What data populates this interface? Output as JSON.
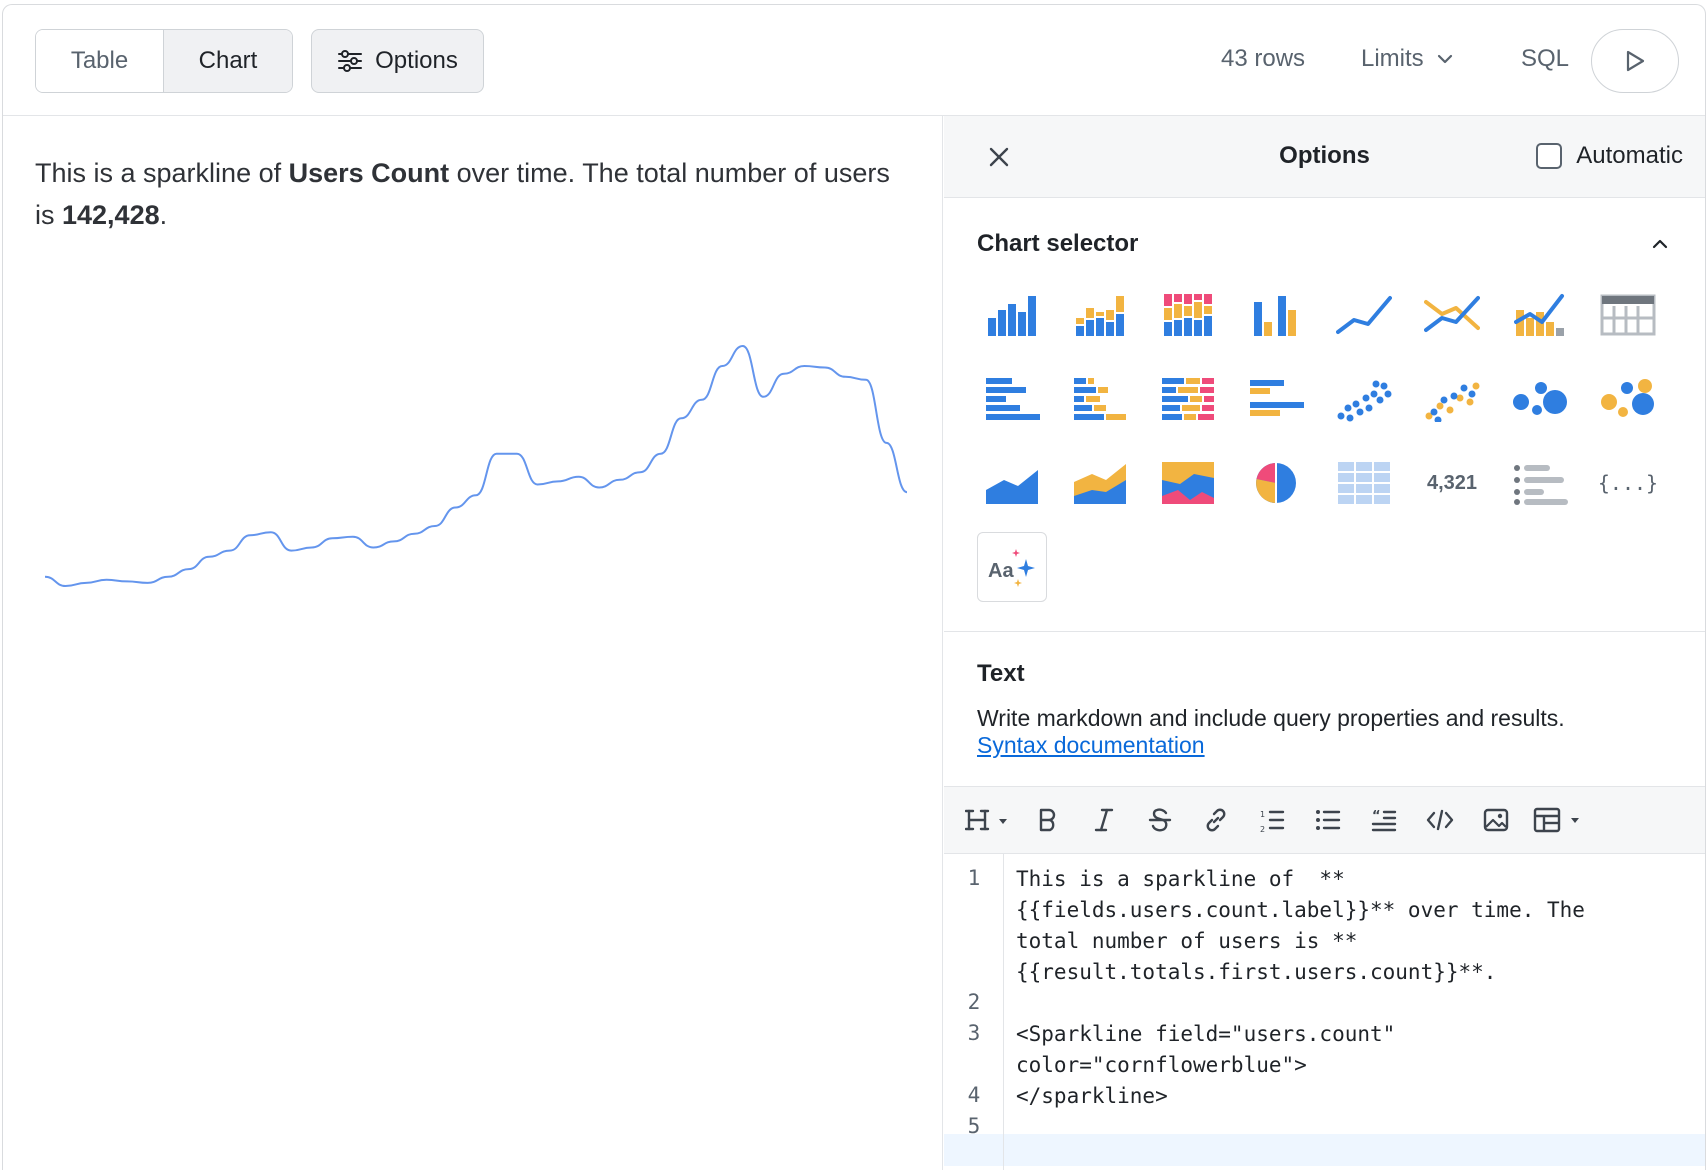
{
  "toolbar": {
    "tab_table": "Table",
    "tab_chart": "Chart",
    "options_label": "Options",
    "rows_label": "43 rows",
    "limits_label": "Limits",
    "sql_label": "SQL"
  },
  "left": {
    "text_pre": "This is a sparkline of ",
    "text_bold1": "Users Count",
    "text_mid": " over time. The total number of users is ",
    "text_bold2": "142,428",
    "text_post": ".",
    "sparkline_color": "#6495ed"
  },
  "chart_data": {
    "type": "line",
    "title": "",
    "xlabel": "",
    "ylabel": "",
    "grid": false,
    "series": [
      {
        "values": [
          95,
          89,
          91,
          93,
          92,
          91,
          95,
          100,
          108,
          112,
          122,
          124,
          112,
          114,
          120,
          121,
          114,
          118,
          123,
          128,
          140,
          148,
          175,
          175,
          155,
          157,
          160,
          153,
          158,
          163,
          175,
          198,
          210,
          232,
          245,
          212,
          227,
          232,
          231,
          225,
          223,
          182,
          150
        ]
      }
    ]
  },
  "panel": {
    "title": "Options",
    "automatic_label": "Automatic",
    "chart_selector_title": "Chart selector",
    "kpi_sample": "4,321",
    "json_sample": "{...}",
    "text_icon_label": "Aa",
    "text_section_title": "Text",
    "text_description": "Write markdown and include query properties and results.",
    "syntax_link": "Syntax documentation"
  },
  "colors": {
    "blue": "#2f7ee0",
    "yellow": "#f2b441",
    "pink": "#ef4b7a",
    "light_blue": "#bcd4f3",
    "grey": "#9aa1a9"
  },
  "editor": {
    "line_numbers": [
      "1",
      "2",
      "3",
      "4",
      "5"
    ],
    "code_lines": [
      "This is a sparkline of  **",
      "{{fields.users.count.label}}** over time. The",
      "total number of users is **",
      "{{result.totals.first.users.count}}**.",
      "",
      "<Sparkline field=\"users.count\"",
      "color=\"cornflowerblue\">",
      "</sparkline>"
    ]
  }
}
